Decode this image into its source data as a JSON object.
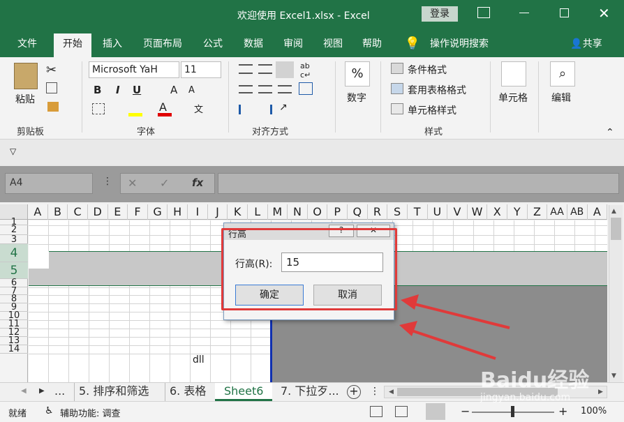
{
  "window": {
    "title": "欢迎使用 Excel1.xlsx  -  Excel",
    "login": "登录"
  },
  "tabs": [
    "文件",
    "开始",
    "插入",
    "页面布局",
    "公式",
    "数据",
    "审阅",
    "视图",
    "帮助"
  ],
  "tell_me": "操作说明搜索",
  "share": "共享",
  "clipboard": {
    "paste": "粘贴",
    "label": "剪贴板"
  },
  "font": {
    "name": "Microsoft YaH",
    "size": "11",
    "bold": "B",
    "italic": "I",
    "underline": "U",
    "grow": "A",
    "shrink": "A",
    "color_a": "A",
    "label": "字体"
  },
  "alignment": {
    "label": "对齐方式"
  },
  "number": {
    "btn": "%",
    "label": "数字"
  },
  "styles": {
    "cond": "条件格式",
    "table": "套用表格格式",
    "cell": "单元格样式",
    "label": "样式"
  },
  "cells": {
    "label": "单元格"
  },
  "editing": {
    "label": "编辑"
  },
  "formula_bar": {
    "name_box": "A4",
    "fx": "fx"
  },
  "columns": [
    "A",
    "B",
    "C",
    "D",
    "E",
    "F",
    "G",
    "H",
    "I",
    "J",
    "K",
    "L",
    "M",
    "N",
    "O",
    "P",
    "Q",
    "R",
    "S",
    "T",
    "U",
    "V",
    "W",
    "X",
    "Y",
    "Z",
    "AA",
    "AB",
    "A"
  ],
  "rows": [
    "1",
    "2",
    "3",
    "4",
    "5",
    "6",
    "7",
    "8",
    "9",
    "10",
    "11",
    "12",
    "13",
    "14"
  ],
  "cell_text": "dll",
  "sheet_tabs": {
    "more": "...",
    "tabs": [
      "5. 排序和筛选",
      "6. 表格",
      "Sheet6",
      "7. 下拉歹..."
    ],
    "active": "Sheet6",
    "add": "+"
  },
  "status": {
    "ready": "就绪",
    "accessibility": "辅助功能: 调查",
    "zoom": "100%"
  },
  "dialog": {
    "title": "行高",
    "help": "?",
    "close": "✕",
    "field_label": "行高(R):",
    "value": "15",
    "ok": "确定",
    "cancel": "取消"
  },
  "watermark": {
    "brand": "Baidu经验",
    "url": "jingyan.baidu.com"
  }
}
